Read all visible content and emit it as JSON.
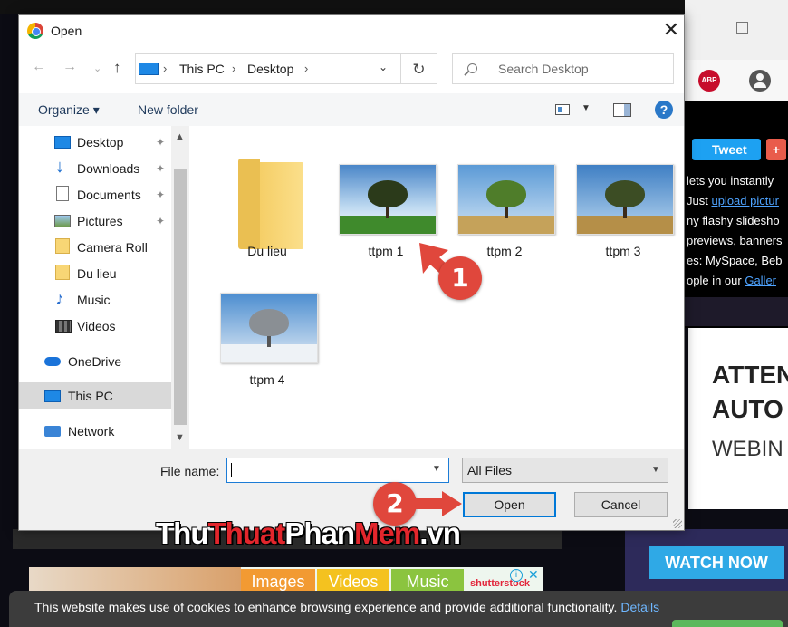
{
  "dialog": {
    "title": "Open",
    "breadcrumb": [
      "This PC",
      "Desktop"
    ],
    "search_placeholder": "Search Desktop",
    "commands": {
      "organize": "Organize ▾",
      "new_folder": "New folder"
    },
    "help": "?",
    "nav_items": [
      {
        "label": "Desktop",
        "icon": "desktop-icon",
        "pinned": true
      },
      {
        "label": "Downloads",
        "icon": "download-icon",
        "pinned": true
      },
      {
        "label": "Documents",
        "icon": "document-icon",
        "pinned": true
      },
      {
        "label": "Pictures",
        "icon": "pictures-icon",
        "pinned": true
      },
      {
        "label": "Camera Roll",
        "icon": "folder-icon",
        "pinned": false
      },
      {
        "label": "Du lieu",
        "icon": "folder-icon",
        "pinned": false
      },
      {
        "label": "Music",
        "icon": "music-icon",
        "pinned": false
      },
      {
        "label": "Videos",
        "icon": "video-icon",
        "pinned": false
      },
      {
        "label": "OneDrive",
        "icon": "cloud-icon",
        "pinned": false
      },
      {
        "label": "This PC",
        "icon": "pc-icon",
        "pinned": false,
        "selected": true
      },
      {
        "label": "Network",
        "icon": "network-icon",
        "pinned": false
      }
    ],
    "files": [
      {
        "name": "Du lieu",
        "type": "folder"
      },
      {
        "name": "ttpm 1",
        "type": "image"
      },
      {
        "name": "ttpm 2",
        "type": "image"
      },
      {
        "name": "ttpm 3",
        "type": "image"
      },
      {
        "name": "ttpm 4",
        "type": "image"
      }
    ],
    "file_name_label": "File name:",
    "file_name_value": "",
    "filter": "All Files",
    "open_label": "Open",
    "cancel_label": "Cancel"
  },
  "annotations": {
    "step1": "1",
    "step2": "2"
  },
  "watermark": {
    "part1": "Thu",
    "part2": "Thuat",
    "part3": "Phan",
    "part4": "Mem",
    "part5": ".vn"
  },
  "background_page": {
    "tweet": "Tweet",
    "plus": "+",
    "abp": "ABP",
    "lines": [
      {
        "pre": "lets you instantly",
        "link": ""
      },
      {
        "pre": "Just ",
        "link": "upload pictur"
      },
      {
        "pre": "ny flashy slidesho",
        "link": ""
      },
      {
        "pre": "previews, banners",
        "link": ""
      },
      {
        "pre": "es: MySpace, Beb",
        "link": ""
      },
      {
        "pre": "ople in our ",
        "link": "Galler"
      }
    ],
    "ad_line1": "ATTEN",
    "ad_line2": "AUTO",
    "ad_line3": "WEBIN",
    "watch_now": "WATCH NOW",
    "ad_tabs": [
      "Images",
      "Videos",
      "Music"
    ],
    "shutterstock": "shutterstock",
    "cookie_text": "This website makes use of cookies to enhance browsing experience and provide additional functionality.",
    "cookie_link": "Details"
  },
  "colors": {
    "accent": "#0078d7",
    "marker": "#e0473c"
  }
}
